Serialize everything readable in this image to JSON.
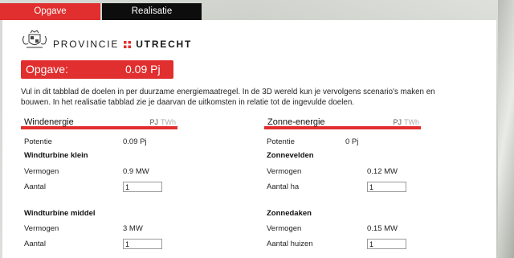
{
  "tabs": [
    {
      "label": "Opgave",
      "active": true
    },
    {
      "label": "Realisatie",
      "active": false
    }
  ],
  "brand": {
    "word1": "PROVINCIE",
    "word2": "UTRECHT"
  },
  "opgave": {
    "label": "Opgave:",
    "value": "0.09 Pj"
  },
  "intro_text": "Vul in dit tabblad de doelen in per duurzame energiemaatregel. In de 3D wereld kun je vervolgens scenario's maken en bouwen. In het realisatie tabblad zie je daarvan de uitkomsten in relatie tot de ingevulde doelen.",
  "units": {
    "pj": "PJ",
    "twh": "TWh"
  },
  "colors": {
    "accent": "#e12e2e",
    "tab_dark": "#0d0d0d"
  },
  "wind": {
    "title": "Windenergie",
    "potentie_label": "Potentie",
    "potentie_value": "0.09 Pj",
    "small": {
      "title": "Windturbine klein",
      "vermogen_label": "Vermogen",
      "vermogen_value": "0.9 MW",
      "aantal_label": "Aantal",
      "aantal_value": "1"
    },
    "medium": {
      "title": "Windturbine middel",
      "vermogen_label": "Vermogen",
      "vermogen_value": "3 MW",
      "aantal_label": "Aantal",
      "aantal_value": "1"
    }
  },
  "solar": {
    "title": "Zonne-energie",
    "potentie_label": "Potentie",
    "potentie_value": "0 Pj",
    "fields": {
      "title": "Zonnevelden",
      "vermogen_label": "Vermogen",
      "vermogen_value": "0.12 MW",
      "aantal_label": "Aantal ha",
      "aantal_value": "1"
    },
    "roofs": {
      "title": "Zonnedaken",
      "vermogen_label": "Vermogen",
      "vermogen_value": "0.15 MW",
      "aantal_label": "Aantal huizen",
      "aantal_value": "1"
    }
  },
  "icons": [
    "crest-icon",
    "brand-separator-icon"
  ]
}
